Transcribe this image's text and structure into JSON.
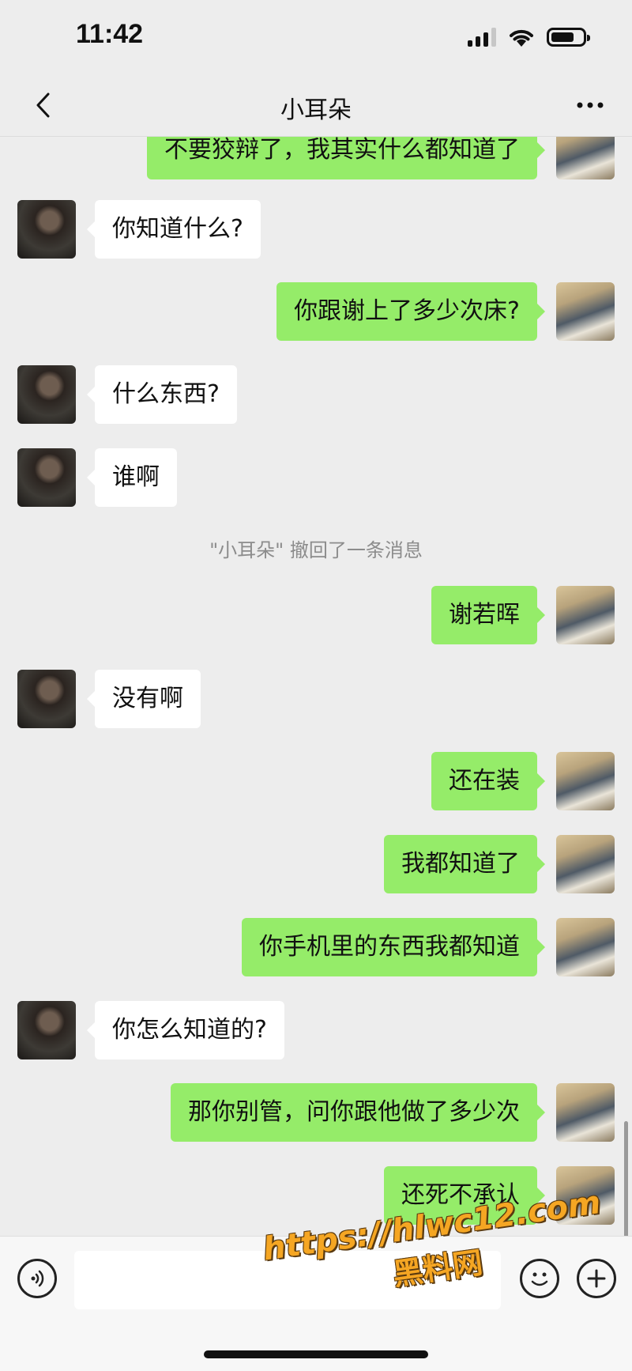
{
  "status_bar": {
    "time": "11:42"
  },
  "nav": {
    "title": "小耳朵"
  },
  "messages": [
    {
      "side": "me",
      "text": "不要狡辩了，我其实什么都知道了"
    },
    {
      "side": "peer",
      "text": "你知道什么?"
    },
    {
      "side": "me",
      "text": "你跟谢上了多少次床?"
    },
    {
      "side": "peer",
      "text": "什么东西?"
    },
    {
      "side": "peer",
      "text": "谁啊"
    },
    {
      "side": "system",
      "text": "\"小耳朵\" 撤回了一条消息"
    },
    {
      "side": "me",
      "text": "谢若晖"
    },
    {
      "side": "peer",
      "text": "没有啊"
    },
    {
      "side": "me",
      "text": "还在装"
    },
    {
      "side": "me",
      "text": "我都知道了"
    },
    {
      "side": "me",
      "text": "你手机里的东西我都知道"
    },
    {
      "side": "peer",
      "text": "你怎么知道的?"
    },
    {
      "side": "me",
      "text": "那你别管，问你跟他做了多少次"
    },
    {
      "side": "me",
      "text": "还死不承认"
    }
  ],
  "input_bar": {
    "value": "",
    "placeholder": ""
  },
  "watermark": {
    "url": "https://hlwc12.com",
    "name": "黑料网"
  },
  "colors": {
    "background": "#ededed",
    "my_bubble": "#95ec69",
    "peer_bubble": "#ffffff",
    "system_text": "#8c8c8c",
    "watermark": "#f5a623"
  }
}
